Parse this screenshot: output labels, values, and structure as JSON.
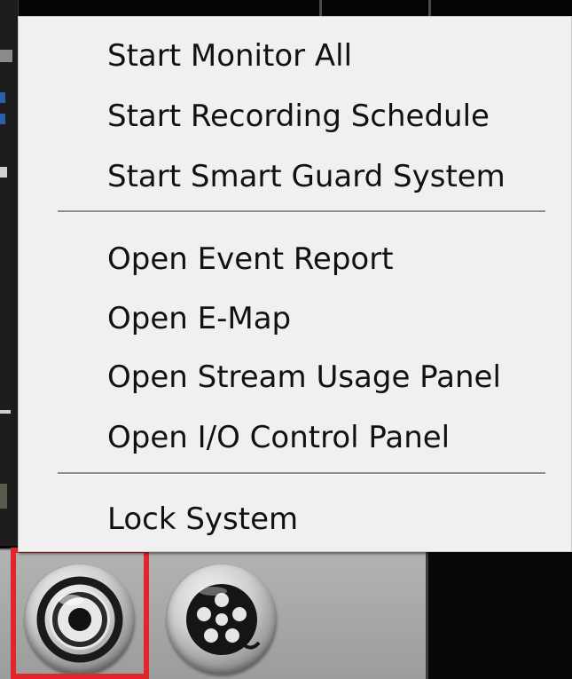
{
  "context_menu": {
    "groups": [
      {
        "items": [
          {
            "label": "Start Monitor All"
          },
          {
            "label": "Start Recording Schedule"
          },
          {
            "label": "Start Smart Guard System"
          }
        ]
      },
      {
        "items": [
          {
            "label": "Open Event Report"
          },
          {
            "label": "Open E-Map"
          },
          {
            "label": "Open Stream Usage Panel"
          },
          {
            "label": "Open I/O Control Panel"
          }
        ]
      },
      {
        "items": [
          {
            "label": "Lock System"
          }
        ]
      }
    ]
  },
  "toolbar": {
    "buttons": [
      {
        "icon": "monitor-icon",
        "highlighted": true
      },
      {
        "icon": "playback-reel-icon",
        "highlighted": false
      }
    ]
  },
  "colors": {
    "menu_background": "#f0f0f0",
    "highlight_border": "#e0262b",
    "toolbar_background": "#a8a8a8"
  }
}
